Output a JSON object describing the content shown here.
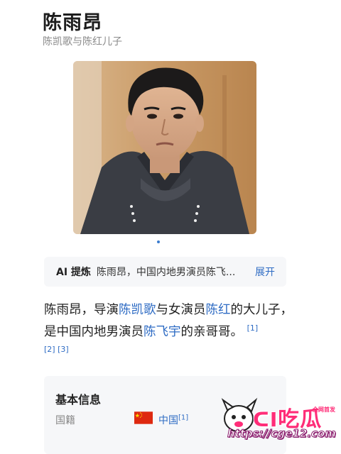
{
  "header": {
    "title": "陈雨昂",
    "subtitle": "陈凯歌与陈红儿子"
  },
  "gallery": {
    "active_index": 0,
    "count": 1
  },
  "ai_summary": {
    "tag": "AI 提炼",
    "text": "陈雨昂，中国内地男演员陈飞...",
    "expand_label": "展开"
  },
  "intro": {
    "part1": "陈雨昂，导演",
    "link1": "陈凯歌",
    "part2": "与女演员",
    "link2": "陈红",
    "part3": "的大儿子，是中国内地男演员",
    "link3": "陈飞宇",
    "part4": "的亲哥哥。",
    "ref1": "[1]",
    "ref2": "[2]",
    "ref3": "[3]"
  },
  "basic_info": {
    "title": "基本信息",
    "nationality_label": "国籍",
    "nationality_value": "中国",
    "nationality_ref": "[1]",
    "flag_icon": "china-flag-icon"
  },
  "watermark": {
    "brand": "吃瓜",
    "tag": "全网首发",
    "url": "https://cge12.com"
  },
  "colors": {
    "link": "#2f6cc4",
    "panel_bg": "#f6f7f9",
    "watermark": "#ff2d78"
  }
}
